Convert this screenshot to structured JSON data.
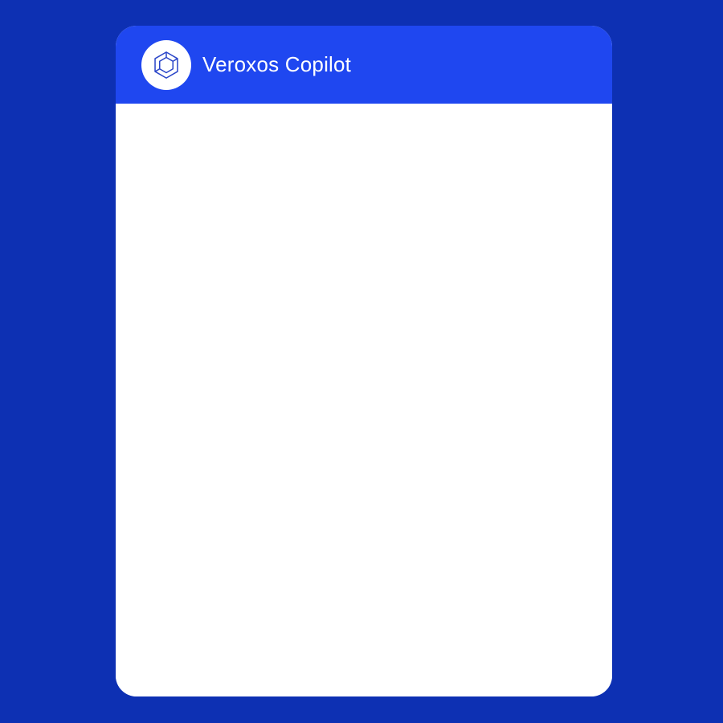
{
  "header": {
    "title": "Veroxos Copilot",
    "logo_icon": "veroxos-hexagon-logo-icon"
  },
  "colors": {
    "page_background": "#0d30b3",
    "header_background": "#1f47f0",
    "panel_background": "#ffffff",
    "logo_stroke": "#2a45c8"
  },
  "messages": []
}
